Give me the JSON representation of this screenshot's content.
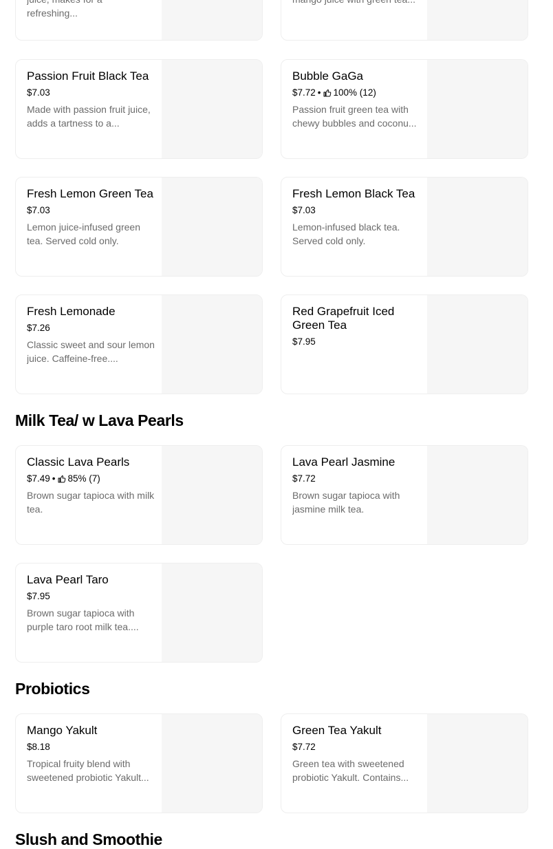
{
  "sections": [
    {
      "title": "",
      "items": [
        {
          "name": "",
          "price": "",
          "description": "juice, makes for a refreshing..."
        },
        {
          "name": "",
          "price": "",
          "description": "mango juice with green tea..."
        },
        {
          "name": "Passion Fruit Black Tea",
          "price": "$7.03",
          "description": "Made with passion fruit juice, adds a tartness to a..."
        },
        {
          "name": "Bubble GaGa",
          "price": "$7.72",
          "rating": "100% (12)",
          "description": "Passion fruit green tea with chewy bubbles and coconu..."
        },
        {
          "name": "Fresh Lemon Green Tea",
          "price": "$7.03",
          "description": "Lemon juice-infused green tea. Served cold only."
        },
        {
          "name": "Fresh Lemon Black Tea",
          "price": "$7.03",
          "description": "Lemon-infused black tea. Served cold only."
        },
        {
          "name": "Fresh Lemonade",
          "price": "$7.26",
          "description": "Classic sweet and sour lemon juice. Caffeine-free...."
        },
        {
          "name": "Red Grapefruit Iced Green Tea",
          "price": "$7.95",
          "description": ""
        }
      ]
    },
    {
      "title": "Milk Tea/ w Lava Pearls",
      "items": [
        {
          "name": "Classic Lava Pearls",
          "price": "$7.49",
          "rating": "85% (7)",
          "description": "Brown sugar tapioca with milk tea."
        },
        {
          "name": "Lava Pearl Jasmine",
          "price": "$7.72",
          "description": "Brown sugar tapioca with jasmine milk tea."
        },
        {
          "name": "Lava Pearl Taro",
          "price": "$7.95",
          "description": "Brown sugar tapioca with purple taro root milk tea...."
        }
      ]
    },
    {
      "title": "Probiotics",
      "items": [
        {
          "name": "Mango Yakult",
          "price": "$8.18",
          "description": "Tropical fruity blend with sweetened probiotic Yakult..."
        },
        {
          "name": "Green Tea Yakult",
          "price": "$7.72",
          "description": "Green tea with sweetened probiotic Yakult. Contains..."
        }
      ]
    },
    {
      "title": "Slush and Smoothie",
      "items": []
    }
  ],
  "icons": {
    "rating": "thumbs-up-icon"
  },
  "colors": {
    "card_border": "#eeeeee",
    "image_placeholder": "#f6f6f6",
    "description_text": "#6b6b6b"
  }
}
